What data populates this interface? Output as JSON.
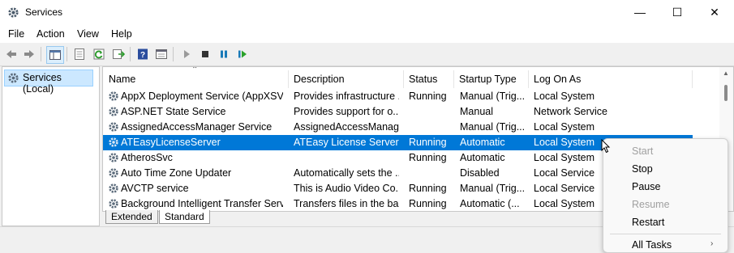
{
  "window": {
    "title": "Services",
    "minimize": "—",
    "maximize": "☐",
    "close": "✕"
  },
  "menu": [
    "File",
    "Action",
    "View",
    "Help"
  ],
  "toolbar_icons": [
    "back-arrow-icon",
    "forward-arrow-icon",
    "console-tree-icon",
    "properties-icon",
    "refresh-icon",
    "export-list-icon",
    "help-icon",
    "detail-view-icon",
    "start-service-icon",
    "stop-service-icon",
    "pause-service-icon",
    "resume-service-icon"
  ],
  "tree": {
    "item": "Services (Local)"
  },
  "columns": [
    "Name",
    "Description",
    "Status",
    "Startup Type",
    "Log On As"
  ],
  "rows": [
    {
      "name": "AppX Deployment Service (AppXSVC)",
      "desc": "Provides infrastructure ...",
      "status": "Running",
      "startup": "Manual (Trig...",
      "logon": "Local System"
    },
    {
      "name": "ASP.NET State Service",
      "desc": "Provides support for o...",
      "status": "",
      "startup": "Manual",
      "logon": "Network Service"
    },
    {
      "name": "AssignedAccessManager Service",
      "desc": "AssignedAccessManag...",
      "status": "",
      "startup": "Manual (Trig...",
      "logon": "Local System"
    },
    {
      "name": "ATEasyLicenseServer",
      "desc": "ATEasy License Server",
      "status": "Running",
      "startup": "Automatic",
      "logon": "Local System"
    },
    {
      "name": "AtherosSvc",
      "desc": "",
      "status": "Running",
      "startup": "Automatic",
      "logon": "Local System"
    },
    {
      "name": "Auto Time Zone Updater",
      "desc": "Automatically sets the ...",
      "status": "",
      "startup": "Disabled",
      "logon": "Local Service"
    },
    {
      "name": "AVCTP service",
      "desc": "This is Audio Video Co...",
      "status": "Running",
      "startup": "Manual (Trig...",
      "logon": "Local Service"
    },
    {
      "name": "Background Intelligent Transfer Servi...",
      "desc": "Transfers files in the ba...",
      "status": "Running",
      "startup": "Automatic (...",
      "logon": "Local System"
    }
  ],
  "selected_row": "ATEasyLicenseServer",
  "tabs": [
    "Extended",
    "Standard"
  ],
  "active_tab": "Standard",
  "context_menu": [
    {
      "label": "Start",
      "enabled": false
    },
    {
      "label": "Stop",
      "enabled": true
    },
    {
      "label": "Pause",
      "enabled": true
    },
    {
      "label": "Resume",
      "enabled": false
    },
    {
      "label": "Restart",
      "enabled": true
    },
    {
      "label": "All Tasks",
      "enabled": true
    }
  ],
  "colors": {
    "selection": "#0078d7",
    "tree_selection": "#cce8ff"
  }
}
